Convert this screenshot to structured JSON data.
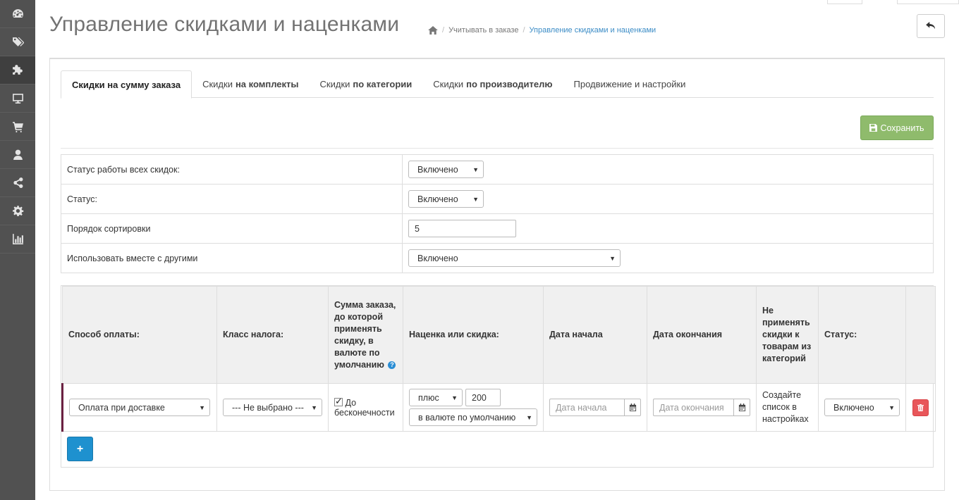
{
  "sidebar": {
    "items": [
      {
        "icon": "dashboard-icon",
        "active": false
      },
      {
        "icon": "tags-icon",
        "active": false
      },
      {
        "icon": "puzzle-icon",
        "active": true
      },
      {
        "icon": "monitor-icon",
        "active": false
      },
      {
        "icon": "cart-icon",
        "active": false
      },
      {
        "icon": "user-icon",
        "active": false
      },
      {
        "icon": "share-icon",
        "active": false
      },
      {
        "icon": "gear-icon",
        "active": false
      },
      {
        "icon": "bar-chart-icon",
        "active": false
      }
    ]
  },
  "header": {
    "title": "Управление скидками и наценками",
    "breadcrumb": {
      "link": "Учитывать в заказе",
      "active": "Управление скидками и наценками"
    }
  },
  "tabs": [
    {
      "normal": "Скидки на сумму заказа",
      "bold": ""
    },
    {
      "normal": "Скидки",
      "bold": "на комплекты"
    },
    {
      "normal": "Скидки",
      "bold": "по категории"
    },
    {
      "normal": "Скидки",
      "bold": "по производителю"
    },
    {
      "normal": "Продвижение и настройки",
      "bold": ""
    }
  ],
  "save_label": "Сохранить",
  "settings": {
    "all_status_label": "Статус работы всех скидок:",
    "all_status_value": "Включено",
    "status_label": "Статус:",
    "status_value": "Включено",
    "sort_label": "Порядок сортировки",
    "sort_value": "5",
    "combine_label": "Использовать вместе с другими",
    "combine_value": "Включено"
  },
  "table": {
    "headers": {
      "payment": "Способ оплаты:",
      "tax": "Класс налога:",
      "amount": "Сумма заказа, до которой применять скидку, в валюте по умолчанию",
      "markup": "Наценка или скидка:",
      "start": "Дата начала",
      "end": "Дата окончания",
      "exclude": "Не применять скидки к товарам из категорий",
      "status": "Статус:"
    },
    "row": {
      "payment": "Оплата при доставке",
      "tax": "--- Не выбрано ---",
      "amount_checkbox": "До бесконечности",
      "sign": "плюс",
      "value": "200",
      "currency": "в валюте по умолчанию",
      "start_placeholder": "Дата начала",
      "end_placeholder": "Дата окончания",
      "exclude_text": "Создайте список в настройках",
      "status": "Включено"
    }
  },
  "add_label": "+",
  "colors": {
    "sidebar": "#515151",
    "save": "#8fbb6c",
    "add": "#1e91cf",
    "delete": "#e8565a",
    "accent": "#3b8cc6"
  }
}
